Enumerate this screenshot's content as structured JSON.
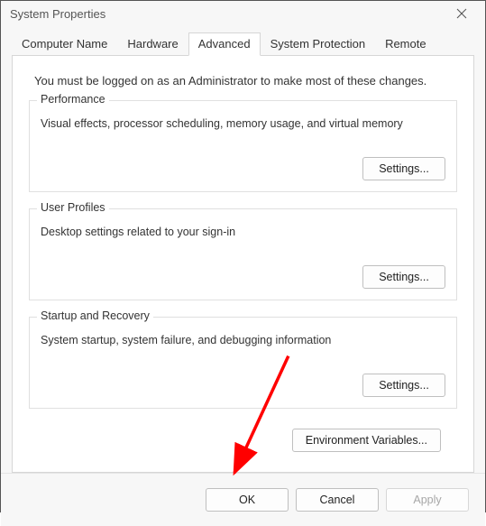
{
  "window": {
    "title": "System Properties"
  },
  "tabs": [
    {
      "label": "Computer Name"
    },
    {
      "label": "Hardware"
    },
    {
      "label": "Advanced"
    },
    {
      "label": "System Protection"
    },
    {
      "label": "Remote"
    }
  ],
  "info": "You must be logged on as an Administrator to make most of these changes.",
  "groups": {
    "performance": {
      "legend": "Performance",
      "desc": "Visual effects, processor scheduling, memory usage, and virtual memory",
      "button": "Settings..."
    },
    "userProfiles": {
      "legend": "User Profiles",
      "desc": "Desktop settings related to your sign-in",
      "button": "Settings..."
    },
    "startupRecovery": {
      "legend": "Startup and Recovery",
      "desc": "System startup, system failure, and debugging information",
      "button": "Settings..."
    }
  },
  "envButton": "Environment Variables...",
  "dialogButtons": {
    "ok": "OK",
    "cancel": "Cancel",
    "apply": "Apply"
  }
}
